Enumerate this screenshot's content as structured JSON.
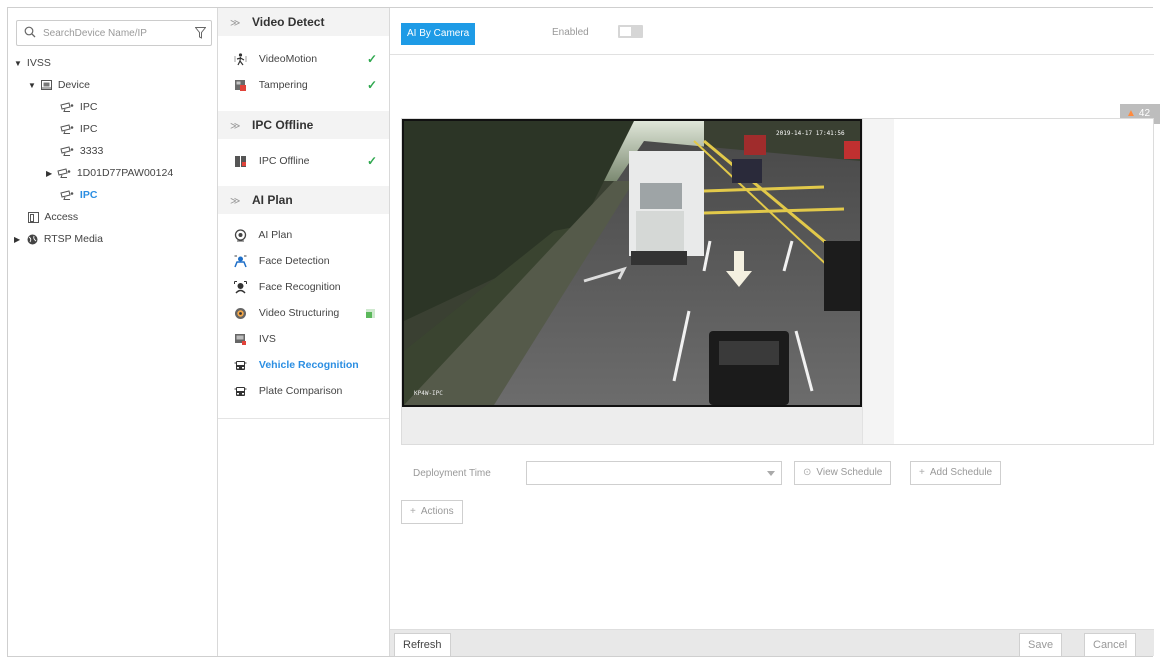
{
  "search": {
    "placeholder": "SearchDevice Name/IP"
  },
  "tree": {
    "root": "IVSS",
    "device": "Device",
    "cameras": [
      "IPC",
      "IPC",
      "3333",
      "1D01D77PAW00124",
      "IPC"
    ],
    "access": "Access",
    "rtsp": "RTSP Media"
  },
  "menu": {
    "video_detect": {
      "title": "Video Detect",
      "items": [
        {
          "label": "VideoMotion",
          "icon": "person-motion-icon",
          "status": "check"
        },
        {
          "label": "Tampering",
          "icon": "tampering-icon",
          "status": "check"
        }
      ]
    },
    "ipc_offline": {
      "title": "IPC Offline",
      "items": [
        {
          "label": "IPC Offline",
          "icon": "ipc-offline-icon",
          "status": "check"
        }
      ]
    },
    "ai_plan": {
      "title": "AI Plan",
      "items": [
        {
          "label": "AI Plan",
          "icon": "ai-plan-icon"
        },
        {
          "label": "Face Detection",
          "icon": "face-detection-icon"
        },
        {
          "label": "Face Recognition",
          "icon": "face-recognition-icon"
        },
        {
          "label": "Video Structuring",
          "icon": "video-structuring-icon",
          "status": "partial"
        },
        {
          "label": "IVS",
          "icon": "ivs-icon"
        },
        {
          "label": "Vehicle Recognition",
          "icon": "vehicle-icon",
          "active": true
        },
        {
          "label": "Plate Comparison",
          "icon": "plate-icon"
        }
      ]
    }
  },
  "content": {
    "ai_by_camera": "AI By Camera",
    "enabled_label": "Enabled",
    "enabled": false,
    "alert_count": "42",
    "video_timestamp": "2019-14-17 17:41:56",
    "video_caption": "KP4W-IPC",
    "deployment_label": "Deployment Time",
    "deployment_value": "",
    "view_schedule": "View Schedule",
    "add_schedule": "Add Schedule",
    "actions": "Actions"
  },
  "footer": {
    "refresh": "Refresh",
    "save": "Save",
    "cancel": "Cancel"
  },
  "colors": {
    "accent": "#1e9be6",
    "active_text": "#2b8ee2",
    "check": "#2fa84f",
    "alert": "#ff8a3d"
  }
}
